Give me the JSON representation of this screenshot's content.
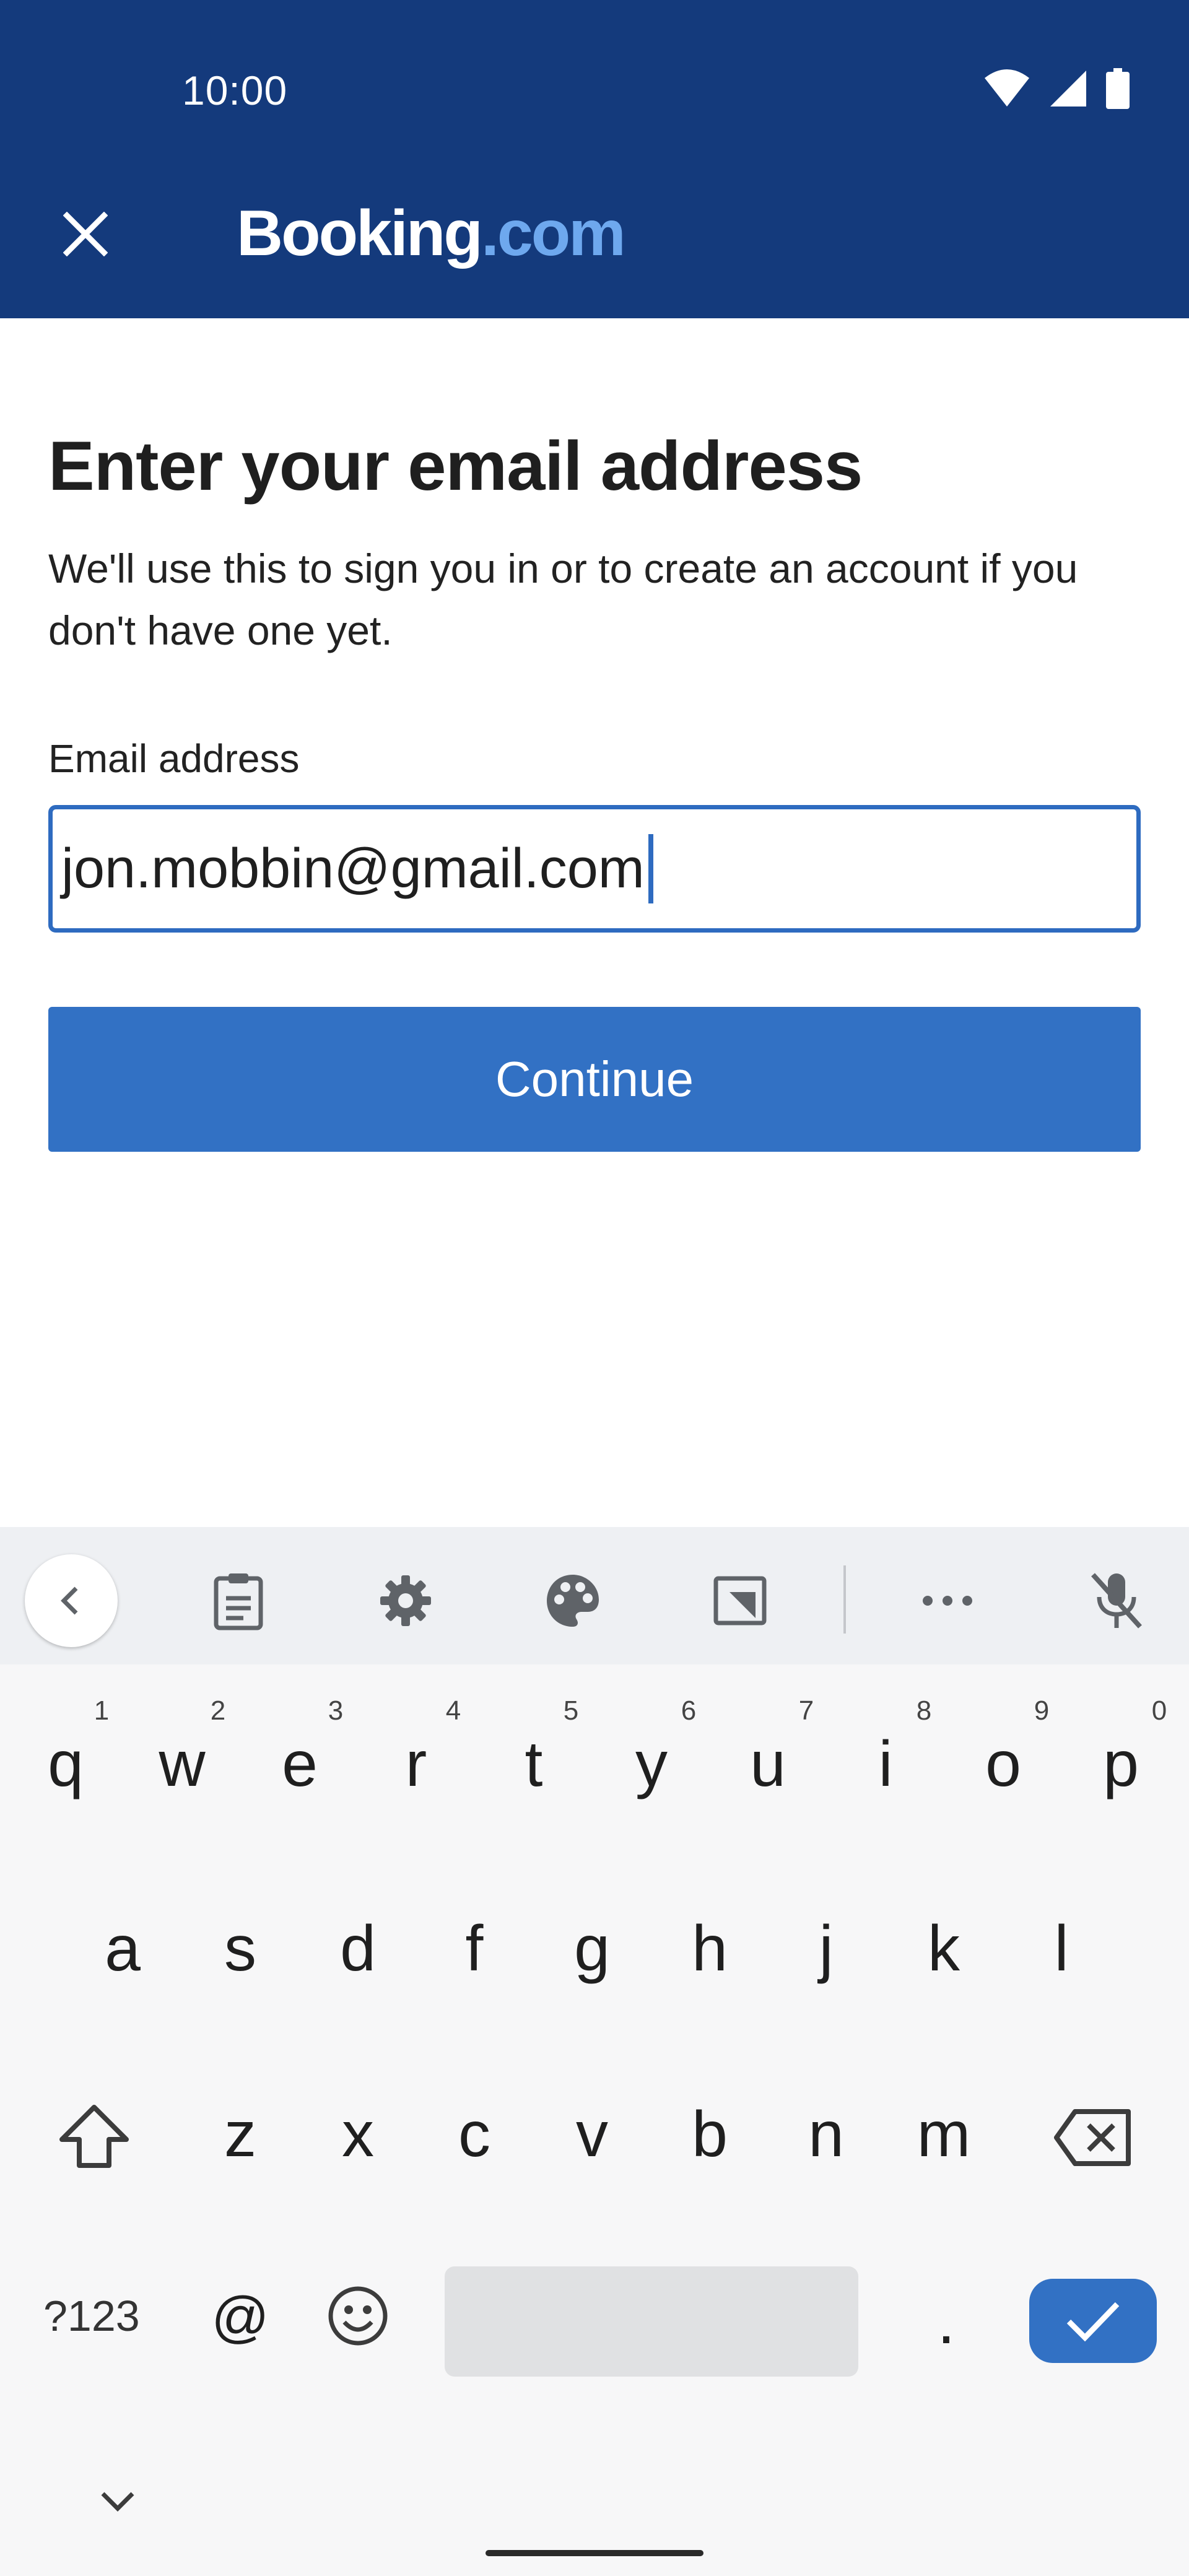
{
  "status_bar": {
    "time": "10:00",
    "icons": [
      "wifi-icon",
      "signal-icon",
      "battery-icon"
    ]
  },
  "app_bar": {
    "close_icon": "close-icon",
    "logo_text": "Booking",
    "logo_suffix": ".com"
  },
  "form": {
    "title": "Enter your email address",
    "description": "We'll use this to sign you in or to create an account if you don't have one yet.",
    "email_label": "Email address",
    "email_value": "jon.mobbin@gmail.com",
    "continue_label": "Continue"
  },
  "keyboard": {
    "toolbar_icons": [
      "chevron-left-icon",
      "clipboard-icon",
      "gear-icon",
      "palette-icon",
      "resize-icon",
      "more-icon",
      "mic-off-icon"
    ],
    "row1": [
      "q",
      "w",
      "e",
      "r",
      "t",
      "y",
      "u",
      "i",
      "o",
      "p"
    ],
    "row1_hints": [
      "1",
      "2",
      "3",
      "4",
      "5",
      "6",
      "7",
      "8",
      "9",
      "0"
    ],
    "row2": [
      "a",
      "s",
      "d",
      "f",
      "g",
      "h",
      "j",
      "k",
      "l"
    ],
    "row3": [
      "z",
      "x",
      "c",
      "v",
      "b",
      "n",
      "m"
    ],
    "symbols_label": "?123",
    "at_label": "@",
    "period_label": "."
  },
  "colors": {
    "app_bar": "#143A7C",
    "accent": "#3271C4",
    "logo_dot": "#6EA8EE"
  }
}
